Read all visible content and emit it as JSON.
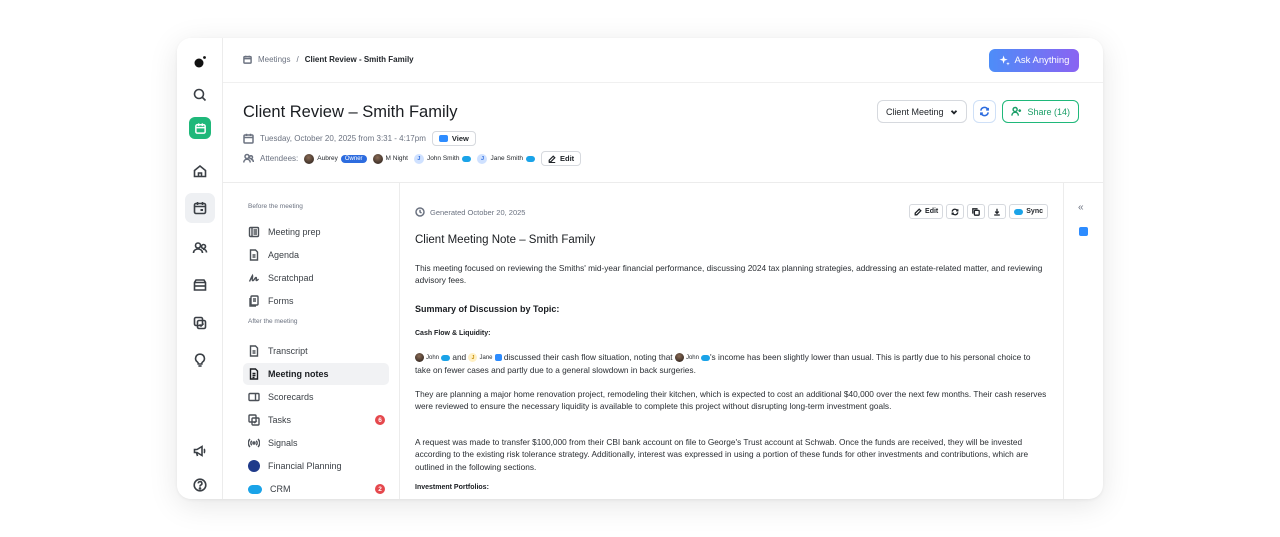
{
  "breadcrumb": {
    "parent": "Meetings",
    "separator": "/",
    "current": "Client Review - Smith Family"
  },
  "ask_button": {
    "label": "Ask Anything"
  },
  "meeting": {
    "title": "Client Review – Smith Family",
    "datetime": "Tuesday, October 20, 2025 from 3:31 - 4:17pm",
    "view_label": "View",
    "attendees_label": "Attendees:",
    "attendees": [
      {
        "name": "Aubrey",
        "role": "Owner"
      },
      {
        "name": "M Night"
      },
      {
        "name": "John Smith",
        "initial": "J"
      },
      {
        "name": "Jane Smith",
        "initial": "J"
      }
    ],
    "edit_label": "Edit",
    "type_select": "Client Meeting",
    "share_label": "Share (14)"
  },
  "nav": {
    "before_label": "Before the meeting",
    "before_items": [
      "Meeting prep",
      "Agenda",
      "Scratchpad",
      "Forms"
    ],
    "after_label": "After the meeting",
    "after_items": [
      {
        "label": "Transcript"
      },
      {
        "label": "Meeting notes",
        "active": true
      },
      {
        "label": "Scorecards"
      },
      {
        "label": "Tasks",
        "badge": "6"
      },
      {
        "label": "Signals"
      },
      {
        "label": "Financial Planning"
      },
      {
        "label": "CRM",
        "badge": "2"
      }
    ]
  },
  "note": {
    "generated": "Generated October 20, 2025",
    "tools": {
      "edit": "Edit",
      "sync": "Sync"
    },
    "title": "Client Meeting Note – Smith Family",
    "intro": "This meeting focused on reviewing the Smiths' mid-year financial performance, discussing 2024 tax planning strategies, addressing an estate-related matter, and reviewing advisory fees.",
    "summary_heading": "Summary of Discussion by Topic:",
    "cash_heading": "Cash Flow & Liquidity:",
    "cash_p1": {
      "john": "John",
      "and": "and",
      "jane": "Jane",
      "text_a": "discussed their cash flow situation, noting that",
      "john2": "John",
      "text_b": "'s income has been slightly lower than usual. This is partly due to his personal choice to take on fewer cases and partly due to a general slowdown in back surgeries."
    },
    "cash_p2": "They are planning a major home renovation project, remodeling their kitchen, which is expected to cost an additional $40,000 over the next few months. Their cash reserves were reviewed to ensure the necessary liquidity is available to complete this project without disrupting long-term investment goals.",
    "cash_p3": "A request was made to transfer $100,000 from their CBI bank account on file to George's Trust account at Schwab. Once the funds are received, they will be invested according to the existing risk tolerance strategy. Additionally, interest was expressed in using a portion of these funds for other investments and contributions, which are outlined in the following sections.",
    "invest_heading": "Investment Portfolios:"
  },
  "right_rail": {
    "collapse": "«"
  },
  "colors": {
    "accent_green": "#1fb87a",
    "accent_blue": "#2d6cdf",
    "badge_red": "#e5484d",
    "ask_gradient_start": "#4d8df8",
    "ask_gradient_end": "#8a63f2"
  }
}
